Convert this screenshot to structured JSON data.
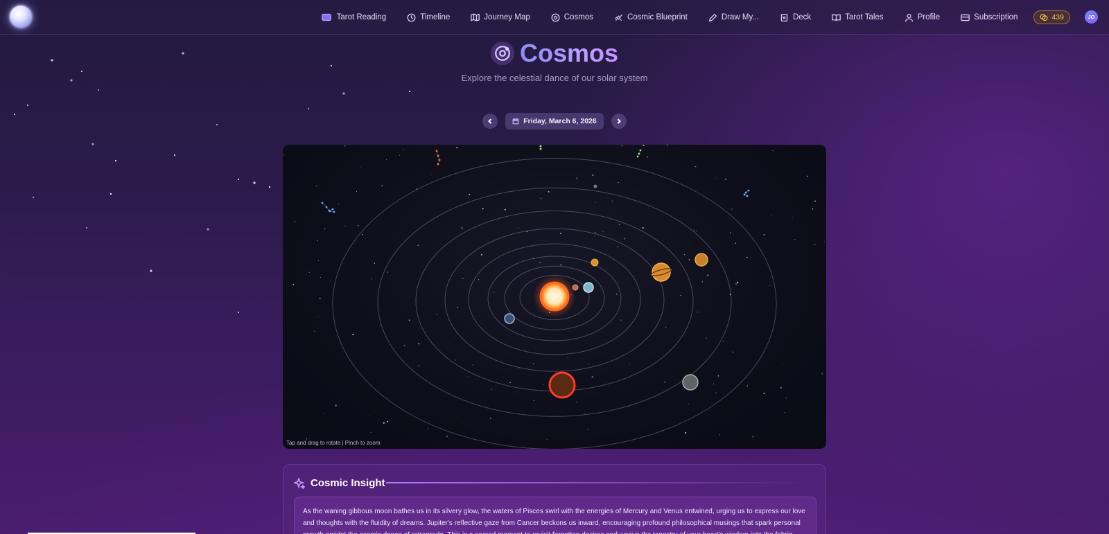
{
  "nav": {
    "items": [
      {
        "label": "Tarot Reading",
        "icon": "cards-icon"
      },
      {
        "label": "Timeline",
        "icon": "clock-icon"
      },
      {
        "label": "Journey Map",
        "icon": "map-icon"
      },
      {
        "label": "Cosmos",
        "icon": "cosmos-icon"
      },
      {
        "label": "Cosmic Blueprint",
        "icon": "satellite-icon"
      },
      {
        "label": "Draw My...",
        "icon": "pencil-icon"
      },
      {
        "label": "Deck",
        "icon": "deck-icon"
      },
      {
        "label": "Tarot Tales",
        "icon": "book-icon"
      },
      {
        "label": "Profile",
        "icon": "user-icon"
      },
      {
        "label": "Subscription",
        "icon": "card-icon"
      }
    ],
    "coins": "439",
    "avatar_initials": "JO"
  },
  "header": {
    "title": "Cosmos",
    "subtitle": "Explore the celestial dance of our solar system"
  },
  "date_nav": {
    "date": "Friday, March 6, 2026"
  },
  "viewer": {
    "hint": "Tap and drag to rotate | Pinch to zoom"
  },
  "insight": {
    "title": "Cosmic Insight",
    "text": "As the waning gibbous moon bathes us in its silvery glow, the waters of Pisces swirl with the energies of Mercury and Venus entwined, urging us to express our love and thoughts with the fluidity of dreams. Jupiter's reflective gaze from Cancer beckons us inward, encouraging profound philosophical musings that spark personal growth amidst the cosmic dance of retrograde. This is a sacred moment to revisit forgotten desires and weave the tapestry of your heart's wisdom into the fabric"
  },
  "colors": {
    "accent": "#b07cff",
    "coin": "#f3c14a",
    "sun": "#ff7a2a"
  }
}
